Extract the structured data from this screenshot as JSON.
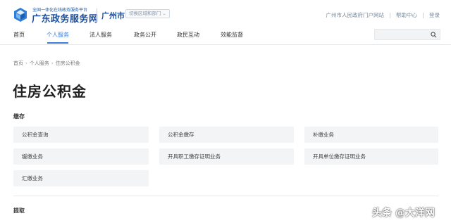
{
  "header": {
    "logo_sub": "全国一体化在线政务服务平台",
    "logo_main": "广东政务服务网",
    "city": "广州市",
    "dept_switch": "切换区域和部门",
    "links": [
      "广州市人民政府门户网站",
      "帮助中心",
      "登录"
    ]
  },
  "nav": {
    "items": [
      "首页",
      "个人服务",
      "法人服务",
      "政务公开",
      "政民互动",
      "效能监督"
    ],
    "active": "个人服务"
  },
  "search": {
    "placeholder": ""
  },
  "breadcrumb": [
    "首页",
    "个人服务",
    "住房公积金"
  ],
  "page_title": "住房公积金",
  "sections": [
    {
      "title": "缴存",
      "items": [
        "公积金查询",
        "公积金缴存",
        "补缴业务",
        "缓缴业务",
        "开具职工缴存证明业务",
        "开具单位缴存证明业务",
        "汇缴业务"
      ]
    },
    {
      "title": "提取",
      "items": []
    }
  ],
  "watermark": "头条 @大洋网",
  "colors": {
    "brand": "#1a4fa0",
    "accent": "#3b7ddd",
    "card_bg": "#f3f4f6"
  }
}
